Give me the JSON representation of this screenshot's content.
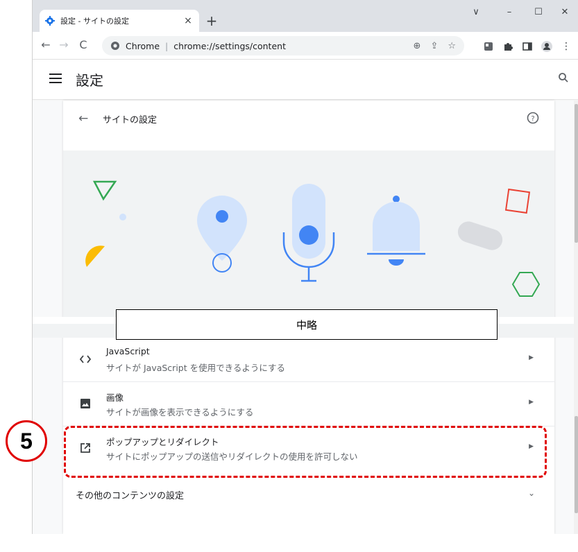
{
  "browser": {
    "tab_title": "設定 - サイトの設定",
    "tab_close": "×",
    "new_tab": "+",
    "window_controls": [
      "∨",
      "–",
      "☐",
      "✕"
    ],
    "omnibox_chip": "Chrome",
    "omnibox_url": "chrome://settings/content",
    "omnibox_tools": [
      "⊕",
      "⇪",
      "☆"
    ]
  },
  "settings_header": {
    "title": "設定"
  },
  "site_settings": {
    "back_label": "サイトの設定",
    "back_arrow": "←",
    "help_icon": "?"
  },
  "elided_marker": "中略",
  "rows": [
    {
      "icon": "code-icon",
      "title": "JavaScript",
      "subtitle": "サイトが JavaScript を使用できるようにする"
    },
    {
      "icon": "image-icon",
      "title": "画像",
      "subtitle": "サイトが画像を表示できるようにする"
    },
    {
      "icon": "popup-icon",
      "title": "ポップアップとリダイレクト",
      "subtitle": "サイトにポップアップの送信やリダイレクトの使用を許可しない"
    }
  ],
  "other_content_settings": "その他のコンテンツの設定",
  "annotation": {
    "step_number": "5",
    "color": "#e00000"
  },
  "colors": {
    "accent_blue": "#4285f4",
    "light_blue": "#d2e3fc",
    "red_square": "#ea4335",
    "green": "#34a853",
    "yellow": "#fbbc04"
  }
}
